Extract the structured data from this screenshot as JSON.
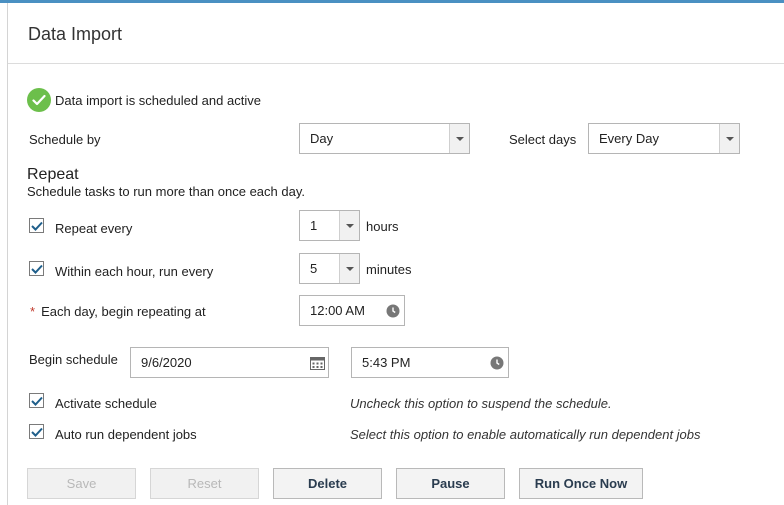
{
  "title": "Data Import",
  "status": {
    "text": "Data import is scheduled and active",
    "icon": "check-circle-icon",
    "color": "#6cbf4b"
  },
  "schedule_by": {
    "label": "Schedule by",
    "value": "Day"
  },
  "select_days": {
    "label": "Select days",
    "value": "Every Day"
  },
  "repeat": {
    "heading": "Repeat",
    "description": "Schedule tasks to run more than once each day.",
    "repeat_every": {
      "label": "Repeat every",
      "checked": true,
      "value": "1",
      "unit": "hours"
    },
    "within_hour": {
      "label": "Within each hour, run every",
      "checked": true,
      "value": "5",
      "unit": "minutes"
    },
    "begin_repeating": {
      "required_mark": "*",
      "label": "Each day, begin repeating at",
      "value": "12:00 AM"
    }
  },
  "begin_schedule": {
    "label": "Begin schedule",
    "date": "9/6/2020",
    "time": "5:43 PM"
  },
  "activate": {
    "label": "Activate schedule",
    "checked": true,
    "hint": "Uncheck this option to suspend the schedule."
  },
  "auto_run": {
    "label": "Auto run dependent jobs",
    "checked": true,
    "hint": "Select this option to enable automatically run dependent jobs"
  },
  "buttons": {
    "save": "Save",
    "reset": "Reset",
    "delete": "Delete",
    "pause": "Pause",
    "run_once": "Run Once Now"
  },
  "colors": {
    "accent": "#4a90c2",
    "checkbox": "#1f5f8b",
    "required": "#c0392b"
  }
}
